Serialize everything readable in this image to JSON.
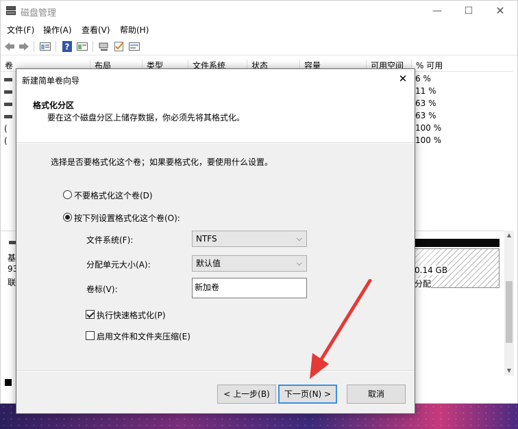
{
  "window": {
    "title": "磁盘管理",
    "controls": {
      "minimize": "—",
      "maximize": "☐",
      "close": "✕"
    }
  },
  "menu": [
    "文件(F)",
    "操作(A)",
    "查看(V)",
    "帮助(H)"
  ],
  "toolbar": {
    "icons": [
      "back-arrow-icon",
      "forward-arrow-icon",
      "disk-list-icon",
      "help-icon",
      "properties-icon",
      "connect-icon",
      "check-icon",
      "settings-icon"
    ]
  },
  "columns": [
    "卷",
    "布局",
    "类型",
    "文件系统",
    "状态",
    "容量",
    "可用空间",
    "% 可用"
  ],
  "volumes": [
    {
      "prefix": "",
      "pct": "6 %"
    },
    {
      "prefix": "",
      "pct": "11 %"
    },
    {
      "prefix": "",
      "pct": "63 %"
    },
    {
      "prefix": "",
      "pct": "63 %"
    },
    {
      "prefix": "(",
      "pct": "100 %"
    },
    {
      "prefix": "(",
      "pct": "100 %"
    }
  ],
  "lower": {
    "disk_lines": [
      "基",
      "93",
      "联"
    ],
    "unallocated_size": "0.14 GB",
    "unallocated_status": "分配"
  },
  "dialog": {
    "title": "新建简单卷向导",
    "close": "✕",
    "heading": "格式化分区",
    "subheading": "要在这个磁盘分区上储存数据，你必须先将其格式化。",
    "intro": "选择是否要格式化这个卷；如果要格式化，要使用什么设置。",
    "radio_no_format": "不要格式化这个卷(D)",
    "radio_format": "按下列设置格式化这个卷(O):",
    "selected_option": "format",
    "fs_label": "文件系统(F):",
    "fs_value": "NTFS",
    "alloc_label": "分配单元大小(A):",
    "alloc_value": "默认值",
    "vol_label": "卷标(V):",
    "vol_value": "新加卷",
    "quick_format": "执行快速格式化(P)",
    "quick_format_checked": true,
    "compression": "启用文件和文件夹压缩(E)",
    "compression_checked": false,
    "back_button": "< 上一步(B)",
    "next_button": "下一页(N) >",
    "cancel_button": "取消"
  },
  "colors": {
    "accent_border": "#3c8fe0",
    "annotation_arrow": "#e53935"
  }
}
